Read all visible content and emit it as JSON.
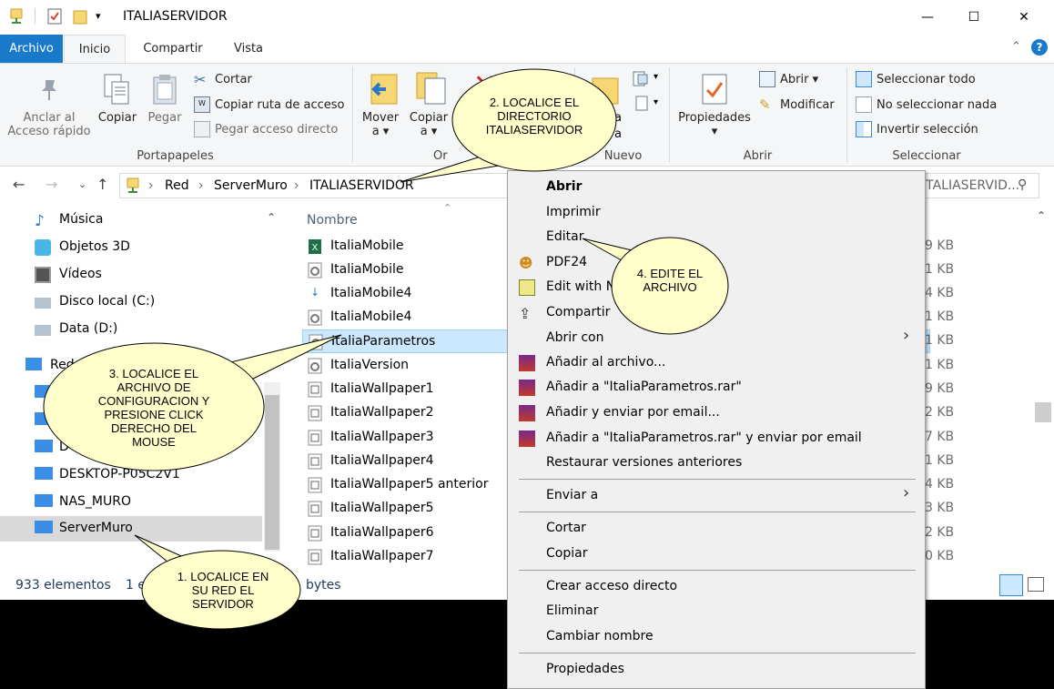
{
  "window": {
    "title": "ITALIASERVIDOR",
    "controls": {
      "minimize": "—",
      "maximize": "☐",
      "close": "✕"
    }
  },
  "tabs": [
    "Archivo",
    "Inicio",
    "Compartir",
    "Vista"
  ],
  "ribbon": {
    "portapapeles": {
      "label": "Portapapeles",
      "anclar": "Anclar al",
      "anclar2": "Acceso rápido",
      "copiar": "Copiar",
      "pegar": "Pegar",
      "cortar": "Cortar",
      "copiar_ruta": "Copiar ruta de acceso",
      "pegar_acceso": "Pegar acceso directo"
    },
    "organizar": {
      "label": "Or",
      "mover": "Mover",
      "mover_sub": "a ▾",
      "copiar": "Copiar",
      "copiar_sub": "a ▾",
      "partial_a": "a",
      "partial_b": "a"
    },
    "nuevo": {
      "label": "Nuevo"
    },
    "abrir": {
      "label": "Abrir",
      "propiedades": "Propiedades",
      "propiedades_sub": "▾",
      "abrir": "Abrir ▾",
      "modificar": "Modificar"
    },
    "seleccionar": {
      "label": "Seleccionar",
      "todo": "Seleccionar todo",
      "nada": "No seleccionar nada",
      "invertir": "Invertir selección"
    }
  },
  "address": {
    "crumbs": [
      "Red",
      "ServerMuro",
      "ITALIASERVIDOR"
    ],
    "sep": "›",
    "search_text": "ITALIASERVID..."
  },
  "nav": {
    "items": [
      "Música",
      "Objetos 3D",
      "Vídeos",
      "Disco local (C:)",
      "Data (D:)",
      "Red",
      "D",
      "D",
      "D",
      "DESKTOP-P05C2V1",
      "NAS_MURO",
      "ServerMuro"
    ]
  },
  "files": {
    "column_name": "Nombre",
    "rows": [
      "ItaliaMobile",
      "ItaliaMobile",
      "ItaliaMobile4",
      "ItaliaMobile4",
      "ItaliaParametros",
      "ItaliaVersion",
      "ItaliaWallpaper1",
      "ItaliaWallpaper2",
      "ItaliaWallpaper3",
      "ItaliaWallpaper4",
      "ItaliaWallpaper5 anterior",
      "ItaliaWallpaper5",
      "ItaliaWallpaper6",
      "ItaliaWallpaper7"
    ],
    "sizes": [
      "9 KB",
      "1 KB",
      "4 KB",
      "1 KB",
      "1 KB",
      "1 KB",
      "9 KB",
      "2 KB",
      "7 KB",
      "1 KB",
      "4 KB",
      "3 KB",
      "2 KB",
      "0 KB"
    ]
  },
  "status": {
    "count": "933 elementos",
    "selected_prefix": "1 el",
    "selected_suffix": "bytes"
  },
  "context_menu": {
    "abrir": "Abrir",
    "imprimir": "Imprimir",
    "editar": "Editar",
    "pdf24": "PDF24",
    "edit_with": "Edit with N",
    "compartir": "Compartir",
    "abrir_con": "Abrir con",
    "anadir_archivo": "Añadir al archivo...",
    "anadir_rar": "Añadir a \"ItaliaParametros.rar\"",
    "anadir_enviar": "Añadir y enviar por email...",
    "anadir_rar_enviar": "Añadir a \"ItaliaParametros.rar\" y enviar por email",
    "restaurar": "Restaurar versiones anteriores",
    "enviar_a": "Enviar a",
    "cortar": "Cortar",
    "copiar": "Copiar",
    "crear_acceso": "Crear acceso directo",
    "eliminar": "Eliminar",
    "cambiar_nombre": "Cambiar nombre",
    "propiedades": "Propiedades"
  },
  "callouts": {
    "c1": [
      "1. LOCALICE EN",
      "SU RED EL",
      "SERVIDOR"
    ],
    "c2": [
      "2. LOCALICE EL",
      "DIRECTORIO",
      "ITALIASERVIDOR"
    ],
    "c3": [
      "3. LOCALICE EL",
      "ARCHIVO DE",
      "CONFIGURACION Y",
      "PRESIONE CLICK",
      "DERECHO DEL",
      "MOUSE"
    ],
    "c4": [
      "4. EDITE EL",
      "ARCHIVO"
    ]
  },
  "colors": {
    "accent": "#1979ca",
    "selection": "#cce8ff",
    "callout_fill": "#ffffcc"
  }
}
